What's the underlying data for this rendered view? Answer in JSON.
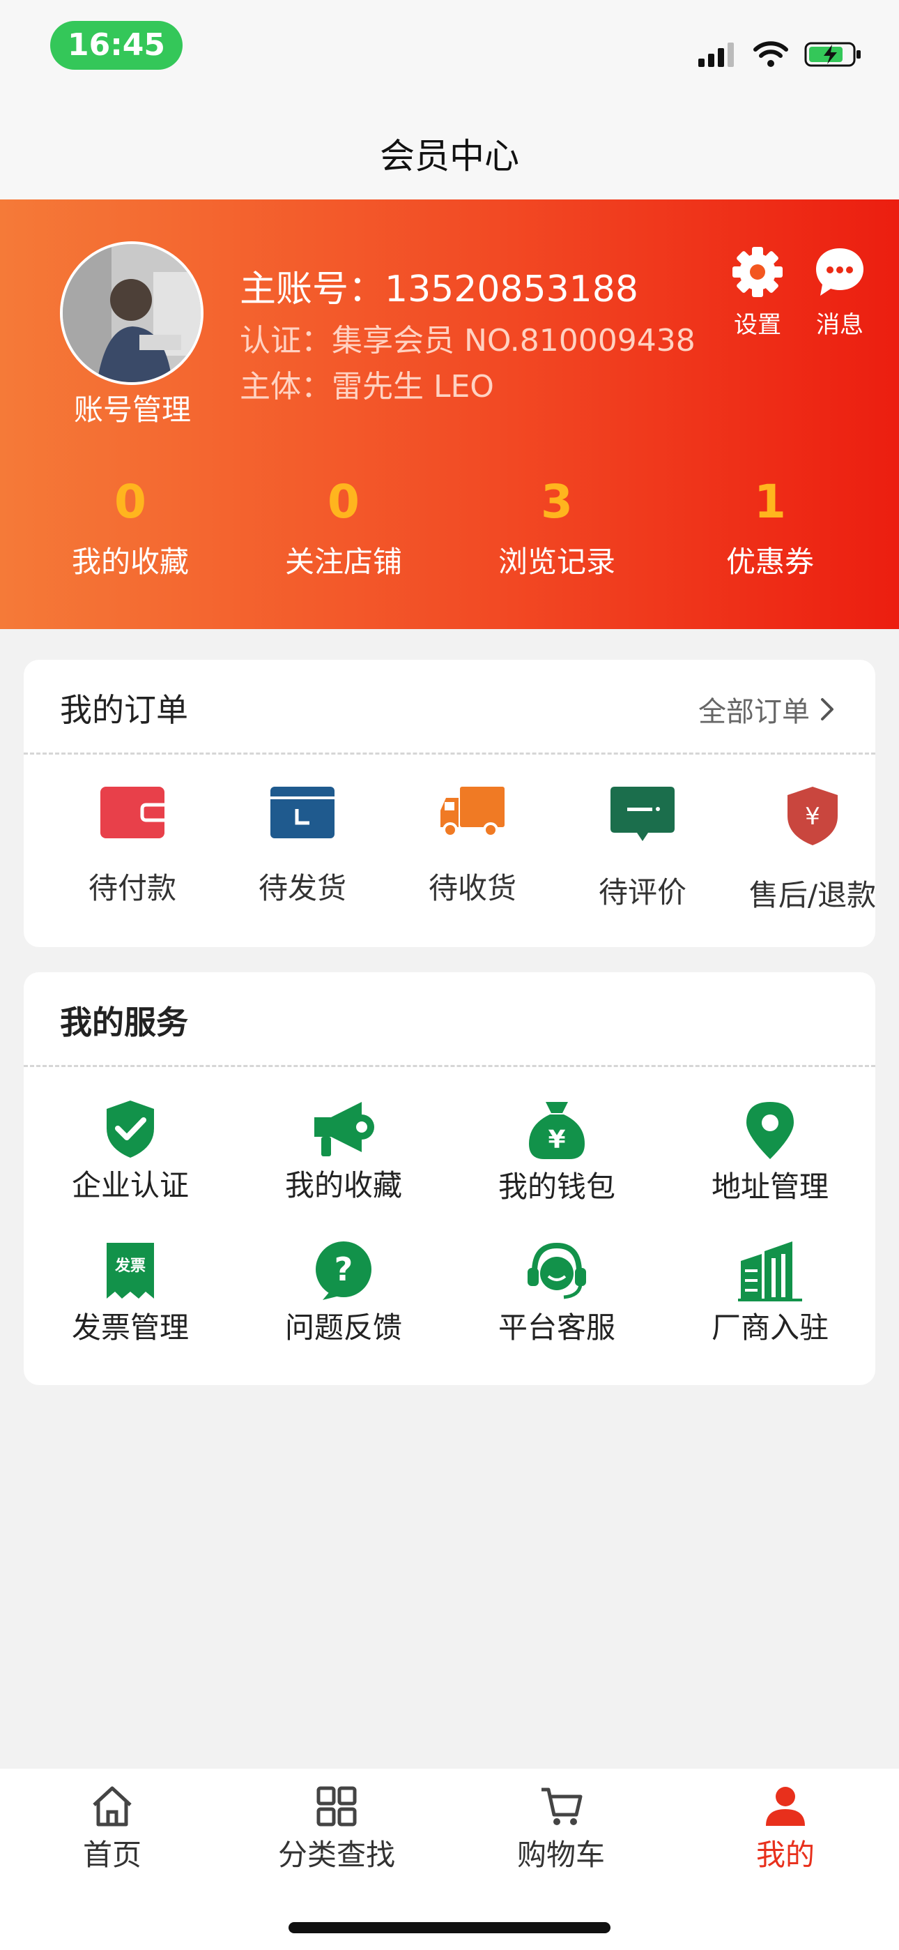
{
  "status_bar": {
    "time": "16:45",
    "icons": [
      "signal-icon",
      "wifi-icon",
      "battery-charging-icon"
    ],
    "accent": "#34c759"
  },
  "nav": {
    "title": "会员中心"
  },
  "profile": {
    "account_manage": "账号管理",
    "main_account": "主账号：13520853188",
    "certification": "认证：集享会员  NO.810009438",
    "entity": "主体：雷先生 LEO",
    "settings_label": "设置",
    "messages_label": "消息"
  },
  "stats": [
    {
      "value": "0",
      "label": "我的收藏"
    },
    {
      "value": "0",
      "label": "关注店铺"
    },
    {
      "value": "3",
      "label": "浏览记录"
    },
    {
      "value": "1",
      "label": "优惠券"
    }
  ],
  "orders": {
    "title": "我的订单",
    "all_label": "全部订单",
    "items": [
      {
        "label": "待付款",
        "icon": "wallet-icon",
        "color": "#e8404a"
      },
      {
        "label": "待发货",
        "icon": "package-icon",
        "color": "#1f5a8e"
      },
      {
        "label": "待收货",
        "icon": "truck-icon",
        "color": "#f07a24"
      },
      {
        "label": "待评价",
        "icon": "comment-icon",
        "color": "#1b6e4c"
      },
      {
        "label": "售后/退款",
        "icon": "refund-shield-icon",
        "color": "#c9463e"
      }
    ]
  },
  "services": {
    "title": "我的服务",
    "accent": "#12924a",
    "items": [
      {
        "label": "企业认证",
        "icon": "verified-shield-icon"
      },
      {
        "label": "我的收藏",
        "icon": "megaphone-icon"
      },
      {
        "label": "我的钱包",
        "icon": "money-bag-icon"
      },
      {
        "label": "地址管理",
        "icon": "location-pin-icon"
      },
      {
        "label": "发票管理",
        "icon": "invoice-icon",
        "badge": "发票"
      },
      {
        "label": "问题反馈",
        "icon": "question-icon"
      },
      {
        "label": "平台客服",
        "icon": "headset-icon"
      },
      {
        "label": "厂商入驻",
        "icon": "buildings-icon"
      }
    ]
  },
  "tabs": [
    {
      "label": "首页",
      "icon": "home-icon"
    },
    {
      "label": "分类查找",
      "icon": "grid-icon"
    },
    {
      "label": "购物车",
      "icon": "cart-icon"
    },
    {
      "label": "我的",
      "icon": "user-icon",
      "active": true,
      "color": "#e8301c"
    }
  ]
}
